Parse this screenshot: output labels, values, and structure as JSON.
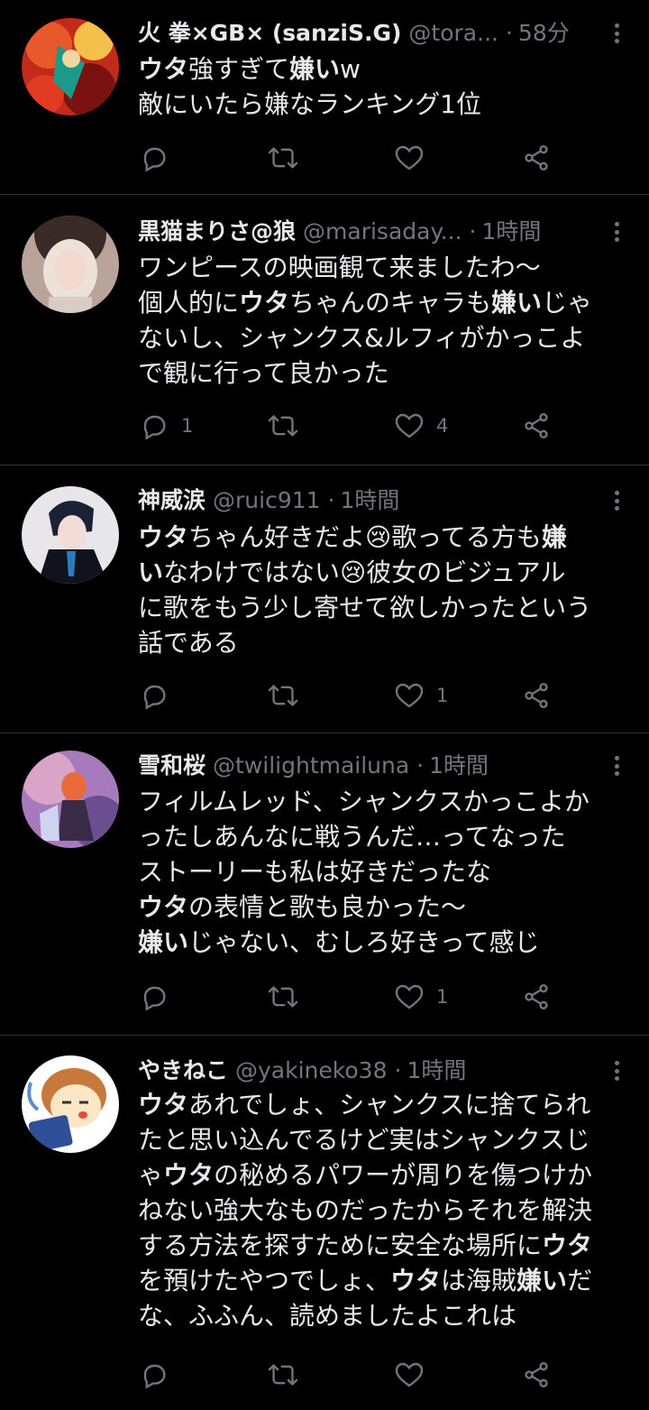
{
  "tweets": [
    {
      "name": "火 拳×GB× (sanziS.G)",
      "handle": "@tora...",
      "time": "58分",
      "lines": [
        [
          {
            "t": "ウタ",
            "b": true
          },
          {
            "t": "強すぎて"
          },
          {
            "t": "嫌い",
            "b": true
          },
          {
            "t": "w"
          }
        ],
        [
          {
            "t": "敵にいたら嫌なランキング1位"
          }
        ]
      ],
      "reply_count": "",
      "like_count": "",
      "avatar": "avatar-red-anime"
    },
    {
      "name": "黒猫まりさ@狼",
      "handle": "@marisaday...",
      "time": "1時間",
      "lines": [
        [
          {
            "t": "ワンピースの映画観て来ましたわ～"
          }
        ],
        [
          {
            "t": "個人的に"
          },
          {
            "t": "ウタ",
            "b": true
          },
          {
            "t": "ちゃんのキャラも"
          },
          {
            "t": "嫌い",
            "b": true
          },
          {
            "t": "じゃ"
          }
        ],
        [
          {
            "t": "ないし、シャンクス&ルフィがかっこよ"
          }
        ],
        [
          {
            "t": "で観に行って良かった"
          }
        ]
      ],
      "reply_count": "1",
      "like_count": "4",
      "avatar": "avatar-cosplay-white"
    },
    {
      "name": "神威涙",
      "handle": "@ruic911",
      "time": "1時間",
      "lines": [
        [
          {
            "t": "ウタ",
            "b": true
          },
          {
            "t": "ちゃん好きだよ😢歌ってる方も"
          },
          {
            "t": "嫌",
            "b": true
          }
        ],
        [
          {
            "t": "い",
            "b": true
          },
          {
            "t": "なわけではない😢彼女のビジュアル"
          }
        ],
        [
          {
            "t": "に歌をもう少し寄せて欲しかったという"
          }
        ],
        [
          {
            "t": "話である"
          }
        ]
      ],
      "reply_count": "",
      "like_count": "1",
      "avatar": "avatar-cosplay-dark"
    },
    {
      "name": "雪和桜",
      "handle": "@twilightmailuna",
      "time": "1時間",
      "lines": [
        [
          {
            "t": "フィルムレッド、シャンクスかっこよか"
          }
        ],
        [
          {
            "t": "ったしあんなに戦うんだ…ってなった"
          }
        ],
        [
          {
            "t": "ストーリーも私は好きだったな"
          }
        ],
        [
          {
            "t": "ウタ",
            "b": true
          },
          {
            "t": "の表情と歌も良かった～"
          }
        ],
        [
          {
            "t": "嫌い",
            "b": true
          },
          {
            "t": "じゃない、むしろ好きって感じ"
          }
        ]
      ],
      "reply_count": "",
      "like_count": "1",
      "avatar": "avatar-illustration-purple"
    },
    {
      "name": "やきねこ",
      "handle": "@yakineko38",
      "time": "1時間",
      "lines": [
        [
          {
            "t": "ウタ",
            "b": true
          },
          {
            "t": "あれでしょ、シャンクスに捨てられ"
          }
        ],
        [
          {
            "t": "たと思い込んでるけど実はシャンクスじ"
          }
        ],
        [
          {
            "t": "ゃ"
          },
          {
            "t": "ウタ",
            "b": true
          },
          {
            "t": "の秘めるパワーが周りを傷つけか"
          }
        ],
        [
          {
            "t": "ねない強大なものだったからそれを解決"
          }
        ],
        [
          {
            "t": "する方法を探すために安全な場所に"
          },
          {
            "t": "ウタ",
            "b": true
          }
        ],
        [
          {
            "t": "を預けたやつでしょ、"
          },
          {
            "t": "ウタ",
            "b": true
          },
          {
            "t": "は海賊"
          },
          {
            "t": "嫌い",
            "b": true
          },
          {
            "t": "だ"
          }
        ],
        [
          {
            "t": "な、ふふん、読めましたよこれは"
          }
        ]
      ],
      "reply_count": "",
      "like_count": "",
      "avatar": "avatar-cartoon-cat"
    }
  ],
  "icons": {
    "reply": "reply-icon",
    "retweet": "retweet-icon",
    "like": "like-icon",
    "share": "share-icon",
    "more": "more-icon"
  },
  "colors": {
    "background": "#000000",
    "text": "#e7e9ea",
    "muted": "#71767b",
    "divider": "#2f3336"
  }
}
